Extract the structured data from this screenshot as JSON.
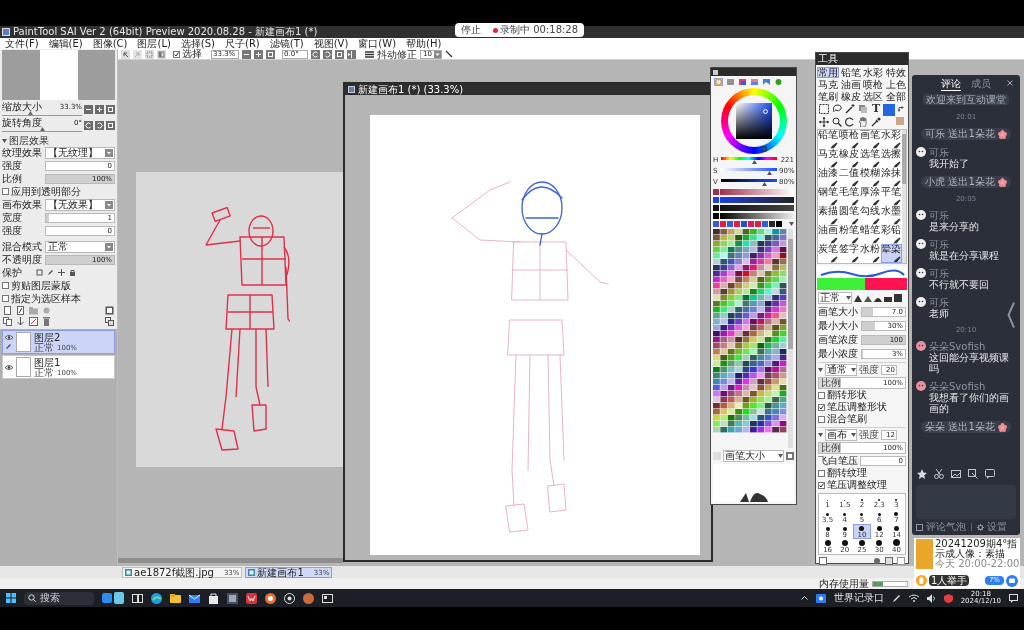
{
  "recording": {
    "stop": "停止",
    "timer": "录制中 00:18:28"
  },
  "window": {
    "title": "PaintTool SAI Ver 2 (64bit) Preview 2020.08.28 - 新建画布1 (*)"
  },
  "menu": [
    "文件(F)",
    "编辑(E)",
    "图像(C)",
    "图层(L)",
    "选择(S)",
    "尺子(R)",
    "滤镜(T)",
    "视图(V)",
    "窗口(W)",
    "帮助(H)"
  ],
  "toolbar": {
    "select": "选择",
    "zoom": "33.3%",
    "angle": "0.0°",
    "stabilizer": "抖动修正",
    "stabilizer_value": "10"
  },
  "navigator": {
    "sliders": [
      {
        "label": "缩放大小",
        "value": "33.3%",
        "level": 0.35
      },
      {
        "label": "旋转角度",
        "value": "0°",
        "level": 0.5
      }
    ]
  },
  "effects": {
    "title": "图层效果",
    "rows": [
      {
        "kind": "dropdown",
        "label": "纹理效果",
        "value": "【无纹理】"
      },
      {
        "kind": "slider",
        "label": "强度",
        "value": "0",
        "level": 0
      },
      {
        "kind": "slider",
        "label": "比例",
        "value": "100%",
        "level": 1
      },
      {
        "kind": "checkbox",
        "label": "应用到透明部分",
        "checked": false
      },
      {
        "kind": "dropdown",
        "label": "画布效果",
        "value": "【无效果】"
      },
      {
        "kind": "slider",
        "label": "宽度",
        "value": "1",
        "level": 0.05
      },
      {
        "kind": "slider",
        "label": "强度",
        "value": "0",
        "level": 0
      }
    ]
  },
  "layer_props": {
    "rows": [
      {
        "kind": "dropdown",
        "label": "混合模式",
        "value": "正常"
      },
      {
        "kind": "slider",
        "label": "不透明度",
        "value": "100%",
        "level": 1
      }
    ]
  },
  "protect": {
    "label": "保护"
  },
  "options": [
    {
      "label": "剪贴图层蒙版",
      "checked": false
    },
    {
      "label": "指定为选区样本",
      "checked": false
    }
  ],
  "layers": [
    {
      "name": "图层2",
      "mode": "正常",
      "opacity": "100%",
      "selected": true,
      "visible": true
    },
    {
      "name": "图层1",
      "mode": "正常",
      "opacity": "100%",
      "selected": false,
      "visible": true
    }
  ],
  "canvas_window": {
    "title": "新建画布1 (*) (33.3%)"
  },
  "color_panel": {
    "modes": [
      {
        "selected": true
      },
      {
        "selected": false
      },
      {
        "selected": false
      },
      {
        "selected": false
      },
      {
        "selected": false
      },
      {
        "selected": false
      }
    ],
    "sliders": [
      {
        "label": "H",
        "value": "221",
        "level": 0.61
      },
      {
        "label": "S",
        "value": "90%",
        "level": 0.9
      },
      {
        "label": "V",
        "value": "80%",
        "level": 0.8
      }
    ],
    "dropdown": "画笔大小"
  },
  "tool_panel": {
    "title": "工具",
    "tabs": [
      {
        "label": "常用",
        "selected": true
      },
      {
        "label": "铅笔",
        "selected": false
      },
      {
        "label": "水彩",
        "selected": false
      },
      {
        "label": "特效",
        "selected": false
      },
      {
        "label": "马克",
        "selected": false
      },
      {
        "label": "油画",
        "selected": false
      },
      {
        "label": "喷枪",
        "selected": false
      },
      {
        "label": "上色",
        "selected": false
      },
      {
        "label": "笔刷",
        "selected": false
      },
      {
        "label": "橡皮",
        "selected": false
      },
      {
        "label": "选区",
        "selected": false
      },
      {
        "label": "全部",
        "selected": false
      }
    ],
    "text_tool": "T",
    "tools": [
      {
        "label": "铅笔",
        "selected": false
      },
      {
        "label": "喷枪",
        "selected": false
      },
      {
        "label": "画笔",
        "selected": false
      },
      {
        "label": "水彩",
        "selected": false
      },
      {
        "label": "马克",
        "selected": false
      },
      {
        "label": "橡皮",
        "selected": false
      },
      {
        "label": "选笔",
        "selected": false
      },
      {
        "label": "选擦",
        "selected": false
      },
      {
        "label": "油漆",
        "selected": false
      },
      {
        "label": "二值",
        "selected": false
      },
      {
        "label": "模糊",
        "selected": false
      },
      {
        "label": "涂抹",
        "selected": false
      },
      {
        "label": "钢笔",
        "selected": false
      },
      {
        "label": "毛笔",
        "selected": false
      },
      {
        "label": "厚涂",
        "selected": false
      },
      {
        "label": "平笔",
        "selected": false
      },
      {
        "label": "素描",
        "selected": false
      },
      {
        "label": "圆笔",
        "selected": false
      },
      {
        "label": "勾线",
        "selected": false
      },
      {
        "label": "水墨",
        "selected": false
      },
      {
        "label": "油画",
        "selected": false
      },
      {
        "label": "粉笔",
        "selected": false
      },
      {
        "label": "蜡笔",
        "selected": false
      },
      {
        "label": "彩铅",
        "selected": false
      },
      {
        "label": "炭笔",
        "selected": false
      },
      {
        "label": "签字",
        "selected": false
      },
      {
        "label": "水粉",
        "selected": false
      },
      {
        "label": "晕染",
        "selected": true
      }
    ],
    "mode": "正常",
    "settings": [
      {
        "label": "画笔大小",
        "value": "7.0",
        "level": 0.25
      },
      {
        "label": "最小大小",
        "value": "30%",
        "level": 0.3
      },
      {
        "label": "画笔浓度",
        "value": "100",
        "level": 1
      },
      {
        "label": "最小浓度",
        "value": "3%",
        "level": 0.03
      }
    ],
    "sections": [
      {
        "title": "通常",
        "value_label": "强度",
        "value": "20",
        "scale_label": "比例",
        "scale": "100%",
        "level": 0.25,
        "options": [
          {
            "label": "翻转形状",
            "checked": false
          },
          {
            "label": "笔压调整形状",
            "checked": true
          },
          {
            "label": "混合笔刷",
            "checked": false
          }
        ]
      },
      {
        "title": "画布",
        "value_label": "强度",
        "value": "12",
        "scale_label": "比例",
        "scale": "100%",
        "level": 0.25,
        "extra": {
          "label": "飞白笔压",
          "value": "0"
        },
        "options": [
          {
            "label": "翻转纹理",
            "checked": false
          },
          {
            "label": "笔压调整纹理",
            "checked": true
          }
        ]
      }
    ],
    "sizes": [
      {
        "label": "1",
        "selected": false
      },
      {
        "label": "1.5",
        "selected": false
      },
      {
        "label": "2",
        "selected": false
      },
      {
        "label": "2.3",
        "selected": false
      },
      {
        "label": "3",
        "selected": false
      },
      {
        "label": "3.5",
        "selected": false
      },
      {
        "label": "4",
        "selected": false
      },
      {
        "label": "5",
        "selected": false
      },
      {
        "label": "6",
        "selected": false
      },
      {
        "label": "7",
        "selected": false
      },
      {
        "label": "8",
        "selected": false
      },
      {
        "label": "9",
        "selected": false
      },
      {
        "label": "10",
        "selected": true
      },
      {
        "label": "12",
        "selected": false
      },
      {
        "label": "14",
        "selected": false
      },
      {
        "label": "16",
        "selected": false
      },
      {
        "label": "20",
        "selected": false
      },
      {
        "label": "25",
        "selected": false
      },
      {
        "label": "30",
        "selected": false
      },
      {
        "label": "40",
        "selected": false
      }
    ]
  },
  "chat": {
    "tabs": [
      {
        "label": "评论",
        "selected": true
      },
      {
        "label": "成员",
        "selected": false
      }
    ],
    "notice": "欢迎来到互动课堂",
    "items": [
      {
        "kind": "time",
        "text": "20:01"
      },
      {
        "kind": "gift",
        "text": "可乐 送出1朵花"
      },
      {
        "kind": "message",
        "user": "可乐",
        "text": "我开始了",
        "color": "#eeeeee"
      },
      {
        "kind": "gift",
        "text": "小虎 送出1朵花"
      },
      {
        "kind": "time",
        "text": "20:05"
      },
      {
        "kind": "message",
        "user": "可乐",
        "text": "是来分享的",
        "color": "#eeeeee"
      },
      {
        "kind": "message",
        "user": "可乐",
        "text": "就是在分享课程",
        "color": "#eeeeee"
      },
      {
        "kind": "message",
        "user": "可乐",
        "text": "不行就不要回",
        "color": "#eeeeee"
      },
      {
        "kind": "message",
        "user": "可乐",
        "text": "老师",
        "color": "#eeeeee"
      },
      {
        "kind": "time",
        "text": "20:10"
      },
      {
        "kind": "message",
        "user": "朵朵Svofish",
        "text": "这回能分享视频课吗",
        "color": "#e8909e"
      },
      {
        "kind": "message",
        "user": "朵朵Svofish",
        "text": "我想看了你们的画画的",
        "color": "#e8909e"
      },
      {
        "kind": "gift",
        "text": "朵朵 送出1朵花"
      }
    ],
    "footer": {
      "bubble": "评论气泡",
      "settings": "设置"
    }
  },
  "ad": {
    "title": "20241209期4°指示成人像：素描",
    "subtitle": "今天 20:00-22:00",
    "raised": "1人举手",
    "button": "7%"
  },
  "canvas_tabs": [
    {
      "label": "ae1872f截图.jpg",
      "zoom": "33%",
      "selected": false
    },
    {
      "label": "新建画布1",
      "zoom": "33%",
      "selected": true
    }
  ],
  "status": {
    "memory": "内存使用量",
    "level": 0.3
  },
  "taskbar": {
    "placeholder": "搜索",
    "tray_label": "世界记录口",
    "time": "20:18",
    "date": "2024/12/10"
  }
}
